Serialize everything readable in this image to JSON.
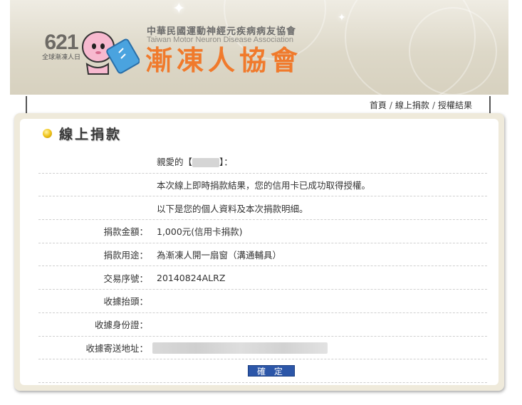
{
  "header": {
    "logo_number": "621",
    "logo_subtitle": "全球漸凍人日",
    "org_full_name_cn": "中華民國運動神經元疾病病友協會",
    "org_full_name_en": "Taiwan Motor Neuron Disease Association",
    "org_short_name": "漸凍人協會"
  },
  "breadcrumb": {
    "items": [
      "首頁",
      "線上捐款",
      "授權結果"
    ],
    "separator": "/"
  },
  "section": {
    "title": "線上捐款"
  },
  "message": {
    "greeting_prefix": "親愛的【",
    "greeting_suffix": "】：",
    "line1": "本次線上即時捐款結果，您的信用卡已成功取得授權。",
    "line2": "以下是您的個人資料及本次捐款明細。"
  },
  "details": [
    {
      "label": "捐款金額：",
      "value": "1,000元(信用卡捐款)"
    },
    {
      "label": "捐款用途：",
      "value": "為漸凍人開一扇窗（溝通輔具）"
    },
    {
      "label": "交易序號：",
      "value": "20140824ALRZ"
    },
    {
      "label": "收據抬頭：",
      "value": ""
    },
    {
      "label": "收據身份證：",
      "value": ""
    },
    {
      "label": "收據寄送地址：",
      "value": ""
    }
  ],
  "confirm_button": "確 定",
  "colors": {
    "brand_orange": "#f07a2c",
    "button_blue": "#2c56a8",
    "panel_bg": "#efeadb"
  }
}
